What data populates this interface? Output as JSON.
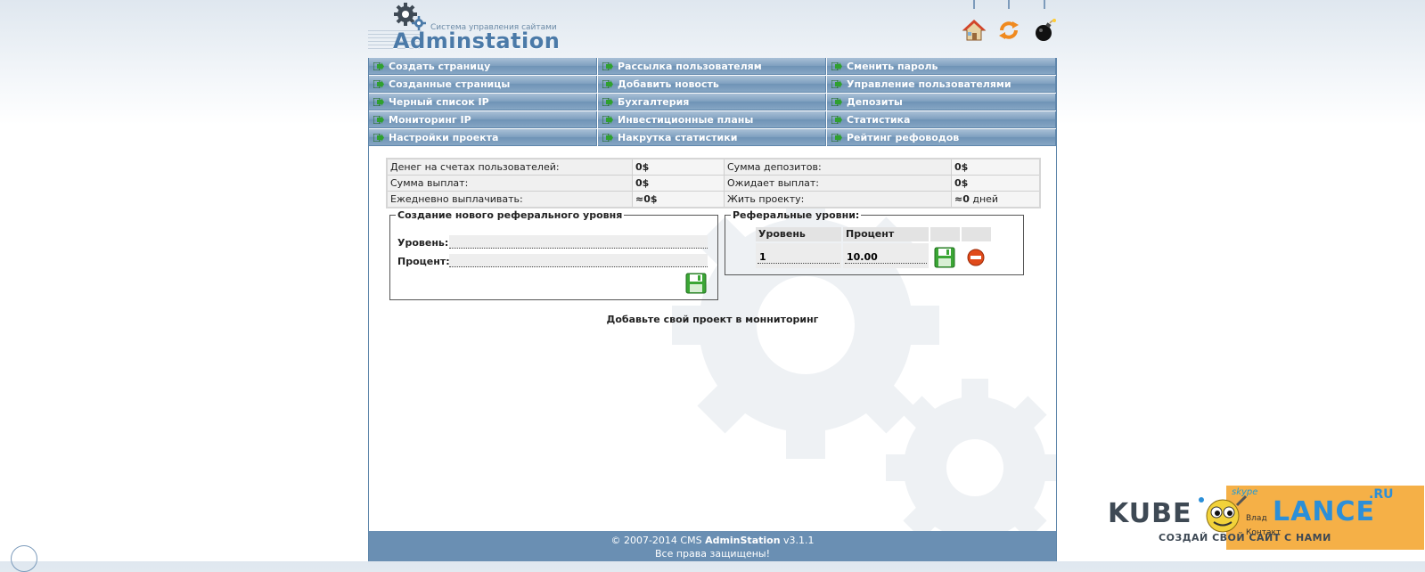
{
  "brand": {
    "name": "Adminstation",
    "tagline": "Система управления сайтами"
  },
  "top_icons": [
    "home-icon",
    "refresh-icon",
    "bomb-icon"
  ],
  "menu": [
    [
      "Создать страницу",
      "Рассылка пользователям",
      "Сменить пароль"
    ],
    [
      "Созданные страницы",
      "Добавить новость",
      "Управление пользователями"
    ],
    [
      "Черный список IP",
      "Бухгалтерия",
      "Депозиты"
    ],
    [
      "Мониторинг IP",
      "Инвестиционные планы",
      "Статистика"
    ],
    [
      "Настройки проекта",
      "Накрутка статистики",
      "Рейтинг рефоводов"
    ]
  ],
  "stats": [
    {
      "l1": "Денег на счетах пользователей:",
      "v1": "0$",
      "l2": "Сумма депозитов:",
      "v2": "0$"
    },
    {
      "l1": "Сумма выплат:",
      "v1": "0$",
      "l2": "Ожидает выплат:",
      "v2": "0$"
    },
    {
      "l1": "Ежедневно выплачивать:",
      "v1": "≈0$",
      "l2": "Жить проекту:",
      "v2_bold": "≈0",
      "v2_rest": " дней"
    }
  ],
  "create_level": {
    "legend": "Создание нового реферального уровня",
    "level_label": "Уровень:",
    "percent_label": "Процент:",
    "level_value": "",
    "percent_value": ""
  },
  "ref_levels": {
    "legend": "Реферальные уровни:",
    "col_level": "Уровень",
    "col_percent": "Процент",
    "rows": [
      {
        "level": "1",
        "percent": "10.00"
      }
    ]
  },
  "monitor_text": "Добавьте свой проект в монниторинг",
  "footer": {
    "copyright_prefix": "© 2007-2014 CMS ",
    "copyright_brand": "AdminStation",
    "copyright_version": " v3.1.1",
    "rights": "Все права защищены!"
  },
  "watermark": {
    "left": "KUBE",
    "right": "LANCE",
    "ru": ".RU",
    "tagline": "СОЗДАЙ СВОЙ САЙТ С НАМИ",
    "skype": "skype",
    "small1": "Влад",
    "small2": "Контакт"
  },
  "colors": {
    "menu_bar": "#7e9fbf",
    "footer": "#6a8fb3",
    "border": "#5f86ab",
    "save_green": "#3ba635",
    "delete_red": "#e04a1a"
  }
}
